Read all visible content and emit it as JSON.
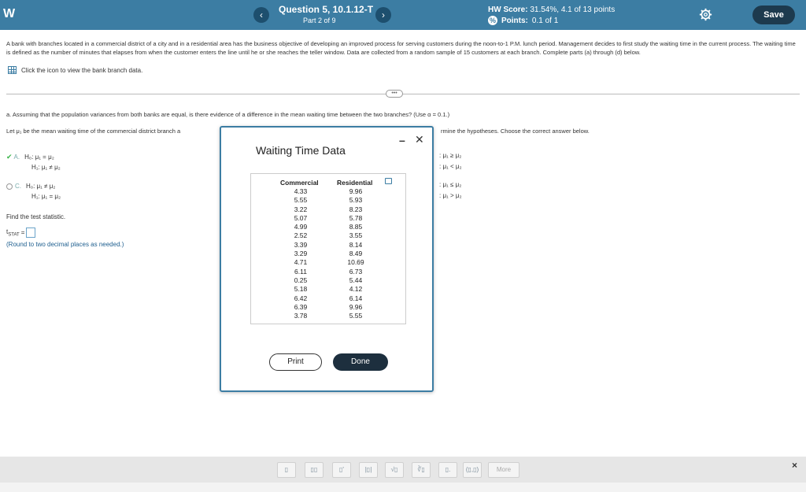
{
  "header": {
    "brand": "W",
    "question_title": "Question 5, 10.1.12-T",
    "question_part": "Part 2 of 9",
    "prev_symbol": "‹",
    "next_symbol": "›",
    "hw_score_label": "HW Score:",
    "hw_score_value": "31.54%, 4.1 of 13 points",
    "points_label": "Points:",
    "points_value": "0.1 of 1",
    "save_label": "Save"
  },
  "question": {
    "text": "A bank with branches located in a commercial district of a city and in a residential area has the business objective of developing an improved process for serving customers during the noon-to-1 P.M. lunch period. Management decides to first study the waiting time in the current process. The waiting time is defined as the number of minutes that elapses from when the customer enters the line until he or she reaches the teller window. Data are collected from a random sample of 15 customers at each branch. Complete parts (a) through (d) below.",
    "data_link": "Click the icon to view the bank branch data."
  },
  "part_a": {
    "prompt": "a. Assuming that the population variances from both banks are equal, is there evidence of a difference in the mean waiting time between the two branches? (Use α = 0.1.)",
    "let_text": "Let μ₁ be the mean waiting time of the commercial district branch a",
    "let_tail": "rmine the hypotheses. Choose the correct answer below.",
    "options": [
      {
        "letter": "A.",
        "h0": "H₀: μ₁ = μ₂",
        "h1": "H₁: μ₁ ≠ μ₂"
      },
      {
        "letter": "C.",
        "h0": "H₀: μ₁ ≠ μ₂",
        "h1": "H₁: μ₁ = μ₂"
      }
    ],
    "right_options": [
      {
        "h0": ": μ₁ ≥ μ₂",
        "h1": ": μ₁ < μ₂"
      },
      {
        "h0": ": μ₁ ≤ μ₂",
        "h1": ": μ₁ > μ₂"
      }
    ],
    "stat_label": "Find the test statistic.",
    "tstat_label": "t",
    "tstat_sub": "STAT",
    "tstat_eq": "=",
    "round_note": "(Round to two decimal places as needed.)"
  },
  "modal": {
    "title": "Waiting Time Data",
    "commercial_header": "Commercial",
    "residential_header": "Residential",
    "commercial": [
      "4.33",
      "5.55",
      "3.22",
      "5.07",
      "4.99",
      "2.52",
      "3.39",
      "3.29",
      "4.71",
      "6.11",
      "0.25",
      "5.18",
      "6.42",
      "6.39",
      "3.78"
    ],
    "residential": [
      "9.96",
      "5.93",
      "8.23",
      "5.78",
      "8.85",
      "3.55",
      "8.14",
      "8.49",
      "10.69",
      "6.73",
      "5.44",
      "4.12",
      "6.14",
      "9.96",
      "5.55"
    ],
    "print_label": "Print",
    "done_label": "Done"
  },
  "toolbar": {
    "tools": [
      "▯",
      "▯▯",
      "▯'",
      "|▯|",
      "√▯",
      "∛▯",
      "▯.",
      "(▯,▯)"
    ],
    "more_label": "More",
    "close_symbol": "×"
  }
}
